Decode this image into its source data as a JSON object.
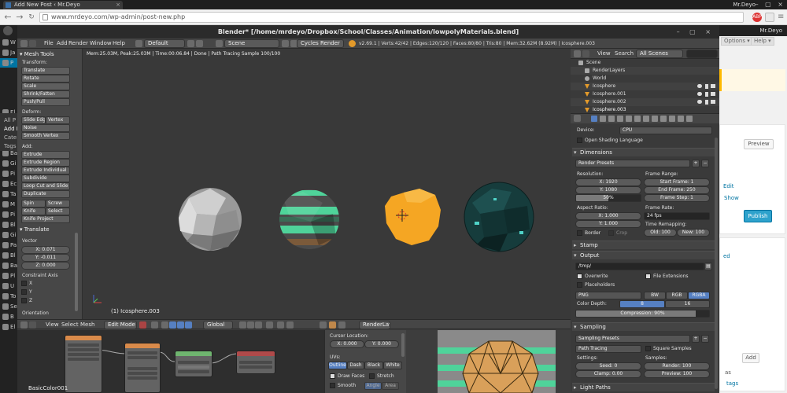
{
  "browser": {
    "tab_title": "Add New Post ‹ Mr.Deyo",
    "tab_close": "×",
    "user_label": "Mr.Deyo",
    "window_controls": "– ▢ ×",
    "back": "←",
    "forward": "→",
    "reload": "C",
    "url": "www.mrdeyo.com/wp-admin/post-new.php",
    "menu_icon": "≡"
  },
  "wp": {
    "howdy": "Mr.Deyo",
    "sidebar": [
      {
        "label": "W",
        "icon": "wordpress-icon"
      },
      {
        "label": "Ja",
        "icon": "jetpack-icon"
      },
      {
        "label": "P",
        "icon": "posts-icon",
        "active": true
      },
      {
        "label": "El",
        "icon": "plugin-icon"
      },
      {
        "label": "Hi",
        "icon": "plugin-icon"
      },
      {
        "label": "Hi",
        "icon": "plugin-icon"
      },
      {
        "label": "Fe",
        "icon": "plugin-icon"
      },
      {
        "label": "Ba",
        "icon": "plugin-icon"
      },
      {
        "label": "Gi",
        "icon": "plugin-icon"
      },
      {
        "label": "Pi",
        "icon": "media-icon"
      },
      {
        "label": "Ec",
        "icon": "plugin-icon"
      },
      {
        "label": "Ta",
        "icon": "plugin-icon"
      },
      {
        "label": "M",
        "icon": "media-icon"
      },
      {
        "label": "Pi",
        "icon": "plugin-icon"
      },
      {
        "label": "Bl",
        "icon": "plugin-icon"
      },
      {
        "label": "Gi",
        "icon": "plugin-icon"
      },
      {
        "label": "Pa",
        "icon": "pages-icon"
      },
      {
        "label": "Bl",
        "icon": "plugin-icon"
      },
      {
        "label": "Ba",
        "icon": "plugin-icon"
      },
      {
        "label": "Pl",
        "icon": "plugins-icon"
      },
      {
        "label": "U",
        "icon": "users-icon"
      },
      {
        "label": "To",
        "icon": "tools-icon"
      },
      {
        "label": "Se",
        "icon": "settings-icon"
      },
      {
        "label": "B",
        "icon": "plugin-icon"
      },
      {
        "label": "El",
        "icon": "plugin-icon"
      }
    ],
    "submenu": [
      "All P",
      "Add N",
      "Cate",
      "Tags"
    ],
    "right": {
      "screen_options": "Options ▾",
      "help": "Help ▾",
      "preview": "Preview",
      "edit_link": "Edit",
      "show_link": "Show",
      "publish": "Publish",
      "ed_link": "ed",
      "add": "Add",
      "tags_link": "tags",
      "as_text": "as"
    }
  },
  "blender": {
    "title": "Blender* [/home/mrdeyo/Dropbox/School/Classes/Animation/lowpolyMaterials.blend]",
    "menus": [
      "File",
      "Add",
      "Render",
      "Window",
      "Help"
    ],
    "layout": "Default",
    "scene": "Scene",
    "engine": "Cycles Render",
    "stats": "v2.69.1 | Verts:42/42 | Edges:120/120 | Faces:80/80 | Tris:80 | Mem:32.62M (8.92M) | Icosphere.003",
    "viewport_info": "Mem:25.03M, Peak:25.03M | Time:00:06.84 | Done | Path Tracing Sample 100/100",
    "object_label": "(1) Icosphere.003",
    "tool_shelf": {
      "title": "Mesh Tools",
      "transform_label": "Transform:",
      "transform_buttons": [
        "Translate",
        "Rotate",
        "Scale",
        "Shrink/Fatten",
        "Push/Pull"
      ],
      "deform_label": "Deform:",
      "deform_row": [
        "Slide Edge",
        "Vertex"
      ],
      "deform_buttons": [
        "Noise",
        "Smooth Vertex"
      ],
      "add_label": "Add:",
      "add_buttons": [
        "Extrude",
        "Extrude Region",
        "Extrude Individual",
        "Subdivide",
        "Loop Cut and Slide",
        "Duplicate"
      ],
      "spin_row": [
        "Spin",
        "Screw"
      ],
      "knife_row": [
        "Knife",
        "Select"
      ],
      "knife_project": "Knife Project",
      "translate_panel": "Translate",
      "vector_label": "Vector",
      "vector": [
        "X: 0.071",
        "Y: -0.011",
        "Z: 0.000"
      ],
      "constraint_label": "Constraint Axis",
      "constraint": [
        "X",
        "Y",
        "Z"
      ],
      "orientation_label": "Orientation"
    },
    "viewport_header": {
      "menus": [
        "View",
        "Select",
        "Mesh"
      ],
      "mode": "Edit Mode",
      "pivot": "Global",
      "render_layer": "RenderLayer"
    },
    "outliner": {
      "view": "View",
      "search": "Search",
      "filter": "All Scenes",
      "rows": [
        "Scene",
        "RenderLayers",
        "World",
        "Icosphere",
        "Icosphere.001",
        "Icosphere.002",
        "Icosphere.003"
      ]
    },
    "properties": {
      "device_label": "Device:",
      "device": "CPU",
      "osl": "Open Shading Language",
      "dimensions": "Dimensions",
      "render_presets": "Render Presets",
      "resolution_label": "Resolution:",
      "res_x": "X: 1920",
      "res_y": "Y: 1080",
      "res_pct": "50%",
      "frame_range_label": "Frame Range:",
      "start_frame": "Start Frame: 1",
      "end_frame": "End Frame: 250",
      "frame_step": "Frame Step: 1",
      "aspect_label": "Aspect Ratio:",
      "aspect_x": "X: 1.000",
      "aspect_y": "Y: 1.000",
      "frame_rate_label": "Frame Rate:",
      "fps": "24 fps",
      "time_remap_label": "Time Remapping:",
      "old": "Old: 100",
      "new": "New: 100",
      "border": "Border",
      "crop": "Crop",
      "stamp": "Stamp",
      "output": "Output",
      "output_path": "/tmp/",
      "overwrite": "Overwrite",
      "file_ext": "File Extensions",
      "placeholders": "Placeholders",
      "format": "PNG",
      "bw": "BW",
      "rgb": "RGB",
      "rgba": "RGBA",
      "color_depth_label": "Color Depth:",
      "depth_8": "8",
      "depth_16": "16",
      "compression": "Compression: 90%",
      "compression_value": 0.9,
      "sampling": "Sampling",
      "sampling_presets": "Sampling Presets",
      "integrator": "Path Tracing",
      "square_samples": "Square Samples",
      "settings_label": "Settings:",
      "samples_label": "Samples:",
      "seed": "Seed: 0",
      "clamp": "Clamp: 0.00",
      "render_samples": "Render: 100",
      "preview_samples": "Preview: 100",
      "light_paths": "Light Paths"
    },
    "uv_panel": {
      "cursor_label": "Cursor Location:",
      "cursor_x": "X: 0.000",
      "cursor_y": "Y: 0.000",
      "uvs_label": "UVs:",
      "draw_modes": [
        "Outline",
        "Dash",
        "Black",
        "White"
      ],
      "draw_faces": "Draw Faces",
      "stretch": "Stretch",
      "smooth": "Smooth",
      "angle": "Angle",
      "area": "Area"
    },
    "node_editor": {
      "label": "BasicColor001"
    }
  },
  "colors": {
    "blender_select": "#5680c2",
    "wp_primary": "#2ea2cc",
    "sphere_orange": "#f5a623",
    "sphere_teal": "#163c3c",
    "stripe_green": "#4fd39a"
  }
}
